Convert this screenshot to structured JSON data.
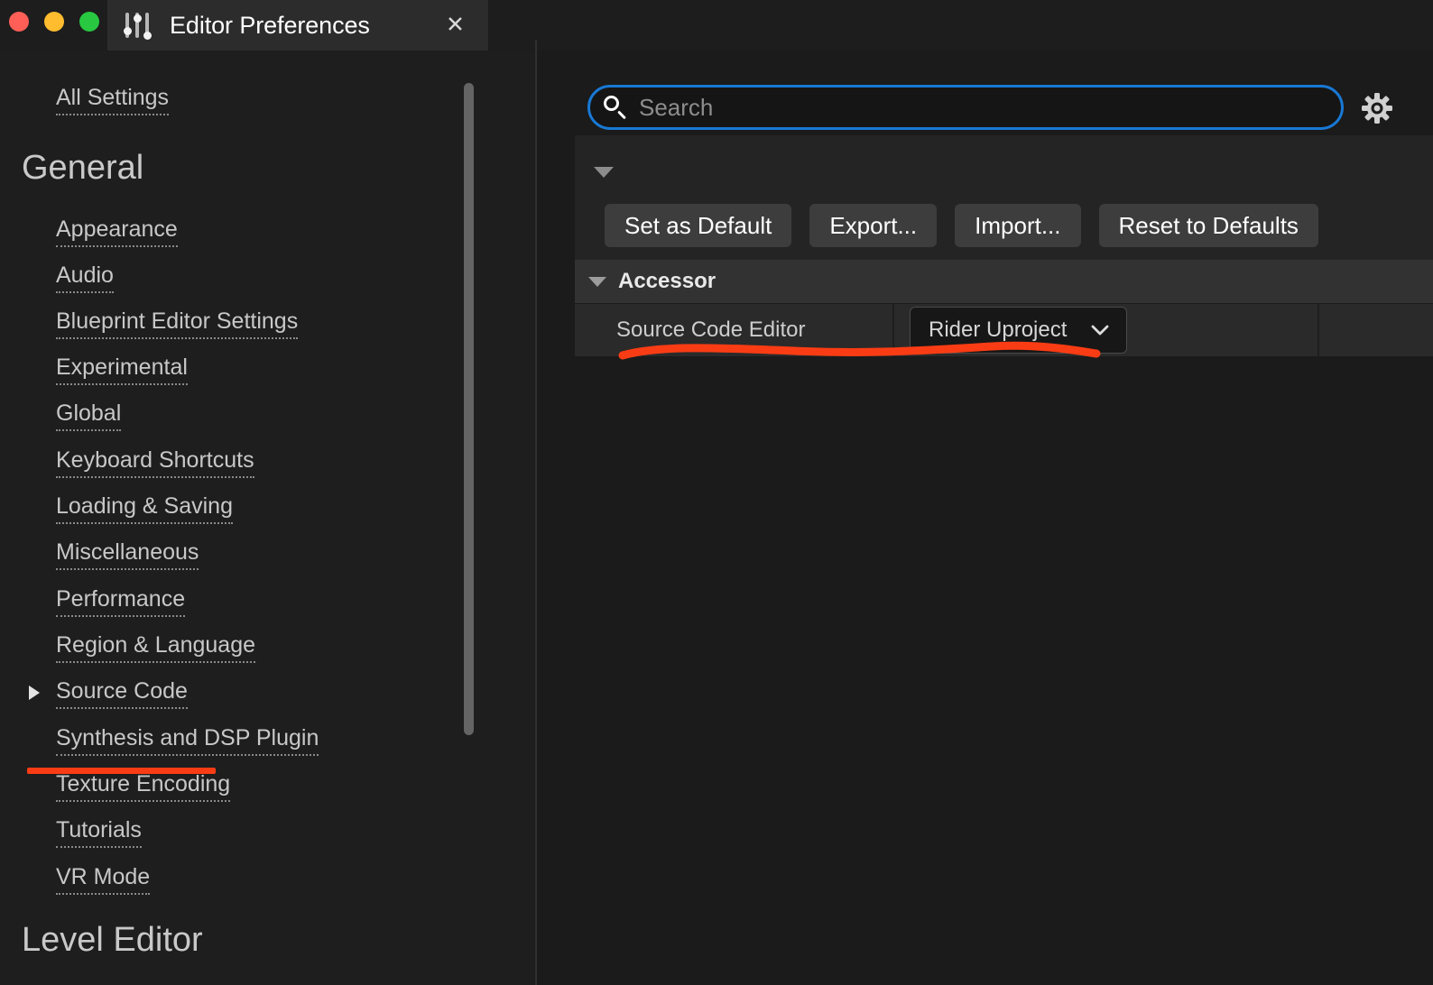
{
  "window": {
    "title": "Editor Preferences",
    "app_icon": "sliders-icon",
    "close_label": "✕",
    "traffic_lights": [
      "close",
      "minimize",
      "maximize"
    ],
    "colors": {
      "traffic_red": "#ff5f57",
      "traffic_yellow": "#febc2e",
      "traffic_green": "#28c840",
      "accent_focus": "#1878d4",
      "annotation_red": "#fa3c14"
    }
  },
  "sidebar": {
    "top_link": "All Settings",
    "sections": [
      {
        "heading": "General",
        "items": [
          {
            "label": "Appearance",
            "expandable": false
          },
          {
            "label": "Audio",
            "expandable": false
          },
          {
            "label": "Blueprint Editor Settings",
            "expandable": false
          },
          {
            "label": "Experimental",
            "expandable": false
          },
          {
            "label": "Global",
            "expandable": false
          },
          {
            "label": "Keyboard Shortcuts",
            "expandable": false
          },
          {
            "label": "Loading & Saving",
            "expandable": false
          },
          {
            "label": "Miscellaneous",
            "expandable": false
          },
          {
            "label": "Performance",
            "expandable": false
          },
          {
            "label": "Region & Language",
            "expandable": false
          },
          {
            "label": "Source Code",
            "expandable": true,
            "selected": true,
            "annotated": true
          },
          {
            "label": "Synthesis and DSP Plugin",
            "expandable": false
          },
          {
            "label": "Texture Encoding",
            "expandable": false
          },
          {
            "label": "Tutorials",
            "expandable": false
          },
          {
            "label": "VR Mode",
            "expandable": false
          }
        ]
      },
      {
        "heading": "Level Editor",
        "items": []
      }
    ]
  },
  "search": {
    "value": "",
    "placeholder": "Search",
    "icon": "search-icon",
    "focused": true
  },
  "settings_gear": {
    "icon": "gear-icon"
  },
  "toolbar": {
    "collapse_icon": "chevron-down-icon",
    "buttons": [
      {
        "label": "Set as Default"
      },
      {
        "label": "Export..."
      },
      {
        "label": "Import..."
      },
      {
        "label": "Reset to Defaults"
      }
    ]
  },
  "property_groups": [
    {
      "name": "Accessor",
      "expanded": true,
      "rows": [
        {
          "name": "Source Code Editor",
          "control": "dropdown",
          "value": "Rider Uproject",
          "annotated": true
        }
      ]
    }
  ],
  "annotations": [
    {
      "type": "underline",
      "target": "sidebar-item-source-code"
    },
    {
      "type": "squiggle-underline",
      "target": "property-row-source-code-editor"
    }
  ]
}
